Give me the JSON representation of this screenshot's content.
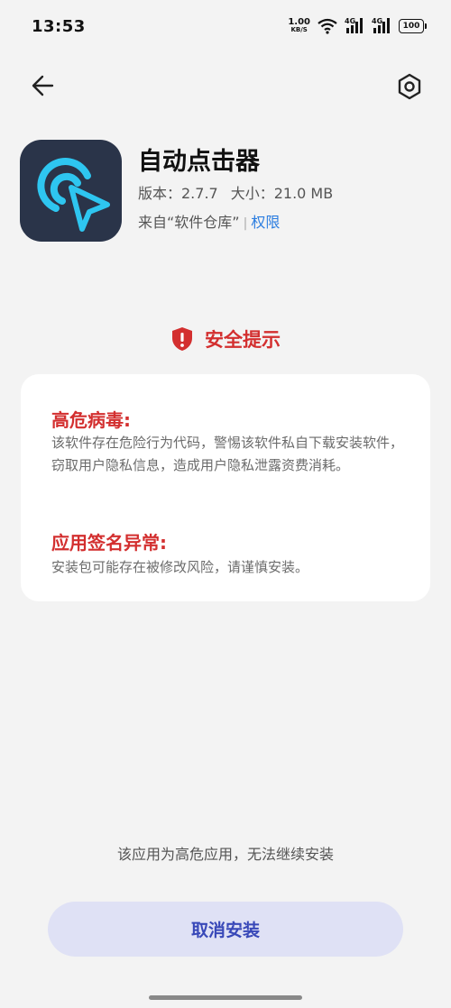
{
  "status_bar": {
    "time": "13:53",
    "net_speed_value": "1.00",
    "net_speed_unit": "KB/S",
    "sim1_label": "4G",
    "sim2_label": "4G",
    "battery_level": "100",
    "icons": [
      "wifi-icon",
      "signal-icon",
      "signal-icon",
      "battery-icon"
    ]
  },
  "top_nav": {
    "back_icon": "arrow-left-icon",
    "settings_icon": "gear-icon"
  },
  "app": {
    "name": "自动点击器",
    "version_label": "版本：2.7.7",
    "size_label": "大小：21.0 MB",
    "source_label": "来自“软件仓库”",
    "divider": "|",
    "permissions_link": "权限",
    "icon": "auto-clicker-app-icon",
    "icon_colors": {
      "background": "#2a3449",
      "accent": "#2ec6f0"
    }
  },
  "security": {
    "heading": "安全提示",
    "icon": "shield-warning-icon",
    "color": "#d32f2f",
    "items": [
      {
        "title": "高危病毒:",
        "description": "该软件存在危险行为代码，警惕该软件私自下载安装软件，窃取用户隐私信息，造成用户隐私泄露资费消耗。"
      },
      {
        "title": "应用签名异常:",
        "description": "安装包可能存在被修改风险，请谨慎安装。"
      }
    ]
  },
  "footer": {
    "note": "该应用为高危应用，无法继续安装",
    "cancel_button": "取消安装",
    "button_color": "#3848b8"
  }
}
